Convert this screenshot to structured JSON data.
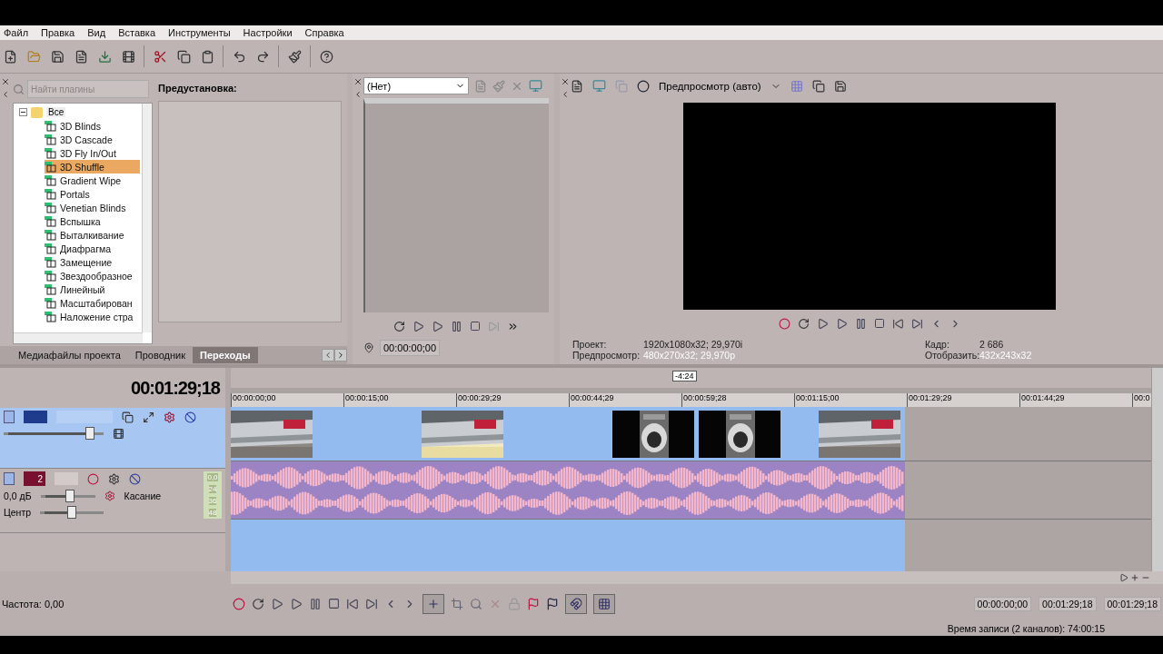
{
  "menu": [
    "Файл",
    "Правка",
    "Вид",
    "Вставка",
    "Инструменты",
    "Настройки",
    "Справка"
  ],
  "explorer": {
    "search": {
      "placeholder": "Найти плагины"
    },
    "tree": {
      "label": "Все",
      "expanded": true,
      "children": [
        {
          "label": "3D Blinds",
          "selected": false
        },
        {
          "label": "3D Cascade",
          "selected": false
        },
        {
          "label": "3D Fly In/Out",
          "selected": false
        },
        {
          "label": "3D Shuffle",
          "selected": true
        },
        {
          "label": "Gradient Wipe",
          "selected": false
        },
        {
          "label": "Portals",
          "selected": false
        },
        {
          "label": "Venetian Blinds",
          "selected": false
        },
        {
          "label": "Вспышка",
          "selected": false
        },
        {
          "label": "Выталкивание",
          "selected": false
        },
        {
          "label": "Диафрагма",
          "selected": false
        },
        {
          "label": "Замещение",
          "selected": false
        },
        {
          "label": "Звездообразное",
          "selected": false
        },
        {
          "label": "Линейный",
          "selected": false
        },
        {
          "label": "Масштабирован",
          "selected": false
        },
        {
          "label": "Наложение стра",
          "selected": false
        }
      ]
    },
    "presets_label": "Предустановка:",
    "tabs": [
      {
        "label": "Медиафайлы проекта",
        "selected": false
      },
      {
        "label": "Проводник",
        "selected": false
      },
      {
        "label": "Переходы",
        "selected": true
      }
    ]
  },
  "trimmer": {
    "dropdown": "(Нет)",
    "time": "00:00:00;00"
  },
  "preview": {
    "mode": "Предпросмотр (авто)",
    "info": [
      {
        "label": "Проект:",
        "value": "1920x1080x32; 29,970i"
      },
      {
        "label": "Предпросмотр:",
        "value": "480x270x32; 29,970p"
      },
      {
        "label": "Кадр:",
        "value": "2 686"
      },
      {
        "label": "Отобразить:",
        "value": "432x243x32"
      }
    ]
  },
  "timeline": {
    "time": "00:01:29;18",
    "region_length": "-4:24",
    "ruler": [
      "00:00:00;00",
      "00:00:15;00",
      "00:00:29;29",
      "00:00:44;29",
      "00:00:59;28",
      "00:01:15;00",
      "00:01:29;29",
      "00:01:44;29",
      "00:0"
    ],
    "tracks": [
      {
        "kind": "video",
        "selected": true,
        "opacity": {
          "level": 0.9
        }
      },
      {
        "kind": "audio",
        "selected": false,
        "number": "2",
        "volume": {
          "reading": "0,0 дБ",
          "level": 0.55
        },
        "pan": {
          "reading": "Центр",
          "level": 0.5
        },
        "mode": "Касание",
        "meter_labels": [
          "0,0",
          "24",
          "36",
          "48"
        ]
      }
    ],
    "rate": "Частота: 0,00",
    "selection_times": [
      "00:00:00;00",
      "00:01:29;18",
      "00:01:29;18"
    ],
    "status": "Время записи (2 каналов): 74:00:15"
  }
}
